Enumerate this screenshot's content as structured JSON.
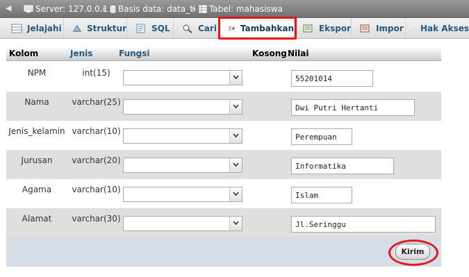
{
  "breadcrumb": {
    "server": "Server: 127.0.0.1",
    "database": "Basis data: data_ti",
    "table": "Tabel: mahasiswa",
    "separator": "»"
  },
  "tabs": [
    {
      "label": "Jelajahi",
      "icon": "browse-icon"
    },
    {
      "label": "Struktur",
      "icon": "structure-icon"
    },
    {
      "label": "SQL",
      "icon": "sql-icon"
    },
    {
      "label": "Cari",
      "icon": "search-icon"
    },
    {
      "label": "Tambahkan",
      "icon": "insert-icon",
      "active": true
    },
    {
      "label": "Ekspor",
      "icon": "export-icon"
    },
    {
      "label": "Impor",
      "icon": "import-icon"
    },
    {
      "label": "Hak Akses",
      "icon": "privileges-icon"
    }
  ],
  "table_header": {
    "kolom": "Kolom",
    "jenis": "Jenis",
    "fungsi": "Fungsi",
    "kosong": "Kosong",
    "nilai": "Nilai"
  },
  "rows": [
    {
      "name": "NPM",
      "type": "int(15)",
      "function": "",
      "value": "55201014"
    },
    {
      "name": "Nama",
      "type": "varchar(25)",
      "function": "",
      "value": "Dwi Putri Hertanti"
    },
    {
      "name": "Jenis_kelamin",
      "type": "varchar(10)",
      "function": "",
      "value": "Perempuan"
    },
    {
      "name": "Jurusan",
      "type": "varchar(20)",
      "function": "",
      "value": "Informatika"
    },
    {
      "name": "Agama",
      "type": "varchar(10)",
      "function": "",
      "value": "Islam"
    },
    {
      "name": "Alamat",
      "type": "varchar(30)",
      "function": "",
      "value": "Jl.Seringgu"
    }
  ],
  "submit_label": "Kirim",
  "colors": {
    "highlight": "#e8141a",
    "link": "#235a81",
    "breadcrumb_bg": "#7f7f7f",
    "row_alt": "#dfdfdf",
    "footer_bg": "#d5dde6"
  }
}
